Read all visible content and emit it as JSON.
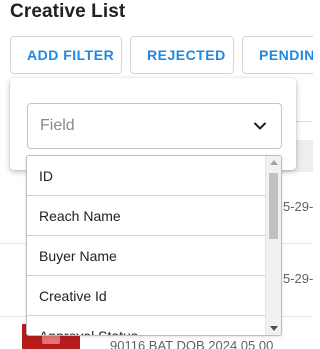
{
  "page": {
    "title": "Creative List"
  },
  "filter_bar": {
    "add_filter_label": "ADD FILTER",
    "rejected_label": "REJECTED",
    "pending_label": "PENDING"
  },
  "filter_popover": {
    "field_select": {
      "placeholder": "Field",
      "icon": "chevron-down-icon"
    },
    "options": [
      "ID",
      "Reach Name",
      "Buyer Name",
      "Creative Id",
      "Approval Status"
    ]
  },
  "table_fragments": {
    "row1_date": "5-29-",
    "row2_date": "5-29-",
    "bottom_row_text": "90116     BAT DOB 2024 05 00"
  },
  "colors": {
    "accent": "#1e88e5",
    "thumbnail": "#b71c1c"
  }
}
